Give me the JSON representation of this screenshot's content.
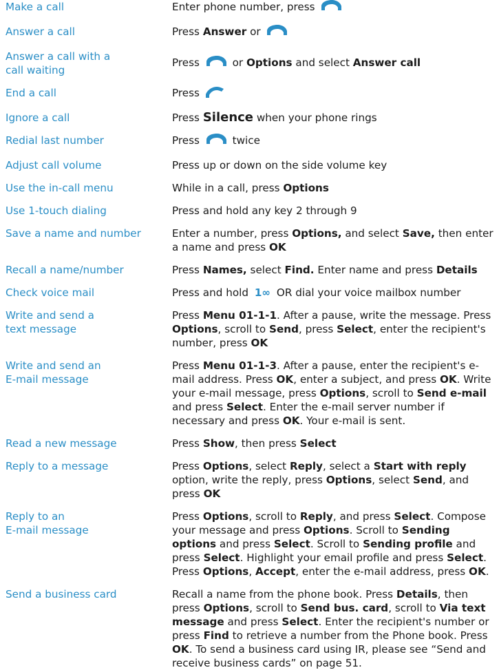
{
  "rows": [
    {
      "task": "Make a call",
      "parts": [
        [
          "t",
          "Enter phone number, press "
        ],
        [
          "icon",
          "send-key-icon"
        ]
      ]
    },
    {
      "task": "Answer a call",
      "parts": [
        [
          "t",
          "Press "
        ],
        [
          "b",
          "Answer"
        ],
        [
          "t",
          " or "
        ],
        [
          "icon",
          "send-key-icon"
        ]
      ]
    },
    {
      "task": "Answer a call with a\ncall waiting",
      "parts": [
        [
          "t",
          "Press "
        ],
        [
          "icon",
          "send-key-icon"
        ],
        [
          "t",
          " or "
        ],
        [
          "b",
          "Options"
        ],
        [
          "t",
          " and select "
        ],
        [
          "b",
          "Answer call"
        ]
      ]
    },
    {
      "task": "End a call",
      "parts": [
        [
          "t",
          "Press "
        ],
        [
          "icon",
          "end-key-icon"
        ]
      ]
    },
    {
      "task": "Ignore a call",
      "parts": [
        [
          "t",
          "Press "
        ],
        [
          "big",
          "Silence"
        ],
        [
          "t",
          " when your phone rings"
        ]
      ]
    },
    {
      "task": "Redial last number",
      "parts": [
        [
          "t",
          "Press "
        ],
        [
          "icon",
          "send-key-icon"
        ],
        [
          "t",
          " twice"
        ]
      ]
    },
    {
      "task": "Adjust call volume",
      "parts": [
        [
          "t",
          "Press up or down on the side volume key"
        ]
      ]
    },
    {
      "task": "Use the in-call menu",
      "parts": [
        [
          "t",
          "While in a call, press "
        ],
        [
          "b",
          "Options"
        ]
      ]
    },
    {
      "task": "Use 1-touch dialing",
      "parts": [
        [
          "t",
          "Press and hold any key 2 through 9"
        ]
      ]
    },
    {
      "task": "Save a name and number",
      "parts": [
        [
          "t",
          "Enter a number, press "
        ],
        [
          "b",
          "Options,"
        ],
        [
          "t",
          " and select "
        ],
        [
          "b",
          "Save,"
        ],
        [
          "t",
          " then enter a name and press "
        ],
        [
          "b",
          "OK"
        ]
      ]
    },
    {
      "task": "Recall a name/number",
      "parts": [
        [
          "t",
          "Press "
        ],
        [
          "b",
          "Names,"
        ],
        [
          "t",
          " select "
        ],
        [
          "b",
          "Find."
        ],
        [
          "t",
          " Enter name and press "
        ],
        [
          "b",
          "Details"
        ]
      ]
    },
    {
      "task": "Check voice mail",
      "parts": [
        [
          "t",
          "Press and hold "
        ],
        [
          "key",
          "1∞"
        ],
        [
          "t",
          " OR dial your voice mailbox number"
        ]
      ]
    },
    {
      "task": "Write and send a\ntext message",
      "parts": [
        [
          "t",
          "Press "
        ],
        [
          "b",
          "Menu 01-1-1"
        ],
        [
          "t",
          ". After a pause, write the message. Press "
        ],
        [
          "b",
          "Options"
        ],
        [
          "t",
          ", scroll to "
        ],
        [
          "b",
          "Send"
        ],
        [
          "t",
          ", press "
        ],
        [
          "b",
          "Select"
        ],
        [
          "t",
          ", enter the recipient's number, press "
        ],
        [
          "b",
          "OK"
        ]
      ]
    },
    {
      "task": "Write and send an\nE-mail message",
      "parts": [
        [
          "t",
          "Press "
        ],
        [
          "b",
          "Menu 01-1-3"
        ],
        [
          "t",
          ". After a pause, enter the recipient's e-mail address. Press "
        ],
        [
          "b",
          "OK"
        ],
        [
          "t",
          ", enter a subject, and press "
        ],
        [
          "b",
          "OK"
        ],
        [
          "t",
          ". Write your e-mail message, press "
        ],
        [
          "b",
          "Options"
        ],
        [
          "t",
          ", scroll to "
        ],
        [
          "b",
          "Send e-mail"
        ],
        [
          "t",
          " and press "
        ],
        [
          "b",
          "Select"
        ],
        [
          "t",
          ". Enter the e-mail server number if necessary and press "
        ],
        [
          "b",
          "OK"
        ],
        [
          "t",
          ". Your e-mail is sent."
        ]
      ]
    },
    {
      "task": "Read a new message",
      "parts": [
        [
          "t",
          "Press "
        ],
        [
          "b",
          "Show"
        ],
        [
          "t",
          ", then press "
        ],
        [
          "b",
          "Select"
        ]
      ]
    },
    {
      "task": "Reply to a message",
      "parts": [
        [
          "t",
          "Press "
        ],
        [
          "b",
          "Options"
        ],
        [
          "t",
          ", select "
        ],
        [
          "b",
          "Reply"
        ],
        [
          "t",
          ", select a "
        ],
        [
          "b",
          "Start with reply"
        ],
        [
          "t",
          " option, write the reply, press "
        ],
        [
          "b",
          "Options"
        ],
        [
          "t",
          ", select "
        ],
        [
          "b",
          "Send"
        ],
        [
          "t",
          ", and press "
        ],
        [
          "b",
          "OK"
        ]
      ]
    },
    {
      "task": "Reply to an\nE-mail message",
      "parts": [
        [
          "t",
          "Press "
        ],
        [
          "b",
          "Options"
        ],
        [
          "t",
          ", scroll to "
        ],
        [
          "b",
          "Reply"
        ],
        [
          "t",
          ", and press "
        ],
        [
          "b",
          "Select"
        ],
        [
          "t",
          ". Compose your message and press "
        ],
        [
          "b",
          "Options"
        ],
        [
          "t",
          ". Scroll to "
        ],
        [
          "b",
          "Sending options"
        ],
        [
          "t",
          " and press "
        ],
        [
          "b",
          "Select"
        ],
        [
          "t",
          ". Scroll to "
        ],
        [
          "b",
          "Sending profile"
        ],
        [
          "t",
          " and press "
        ],
        [
          "b",
          "Select"
        ],
        [
          "t",
          ". Highlight your email profile and press "
        ],
        [
          "b",
          "Select"
        ],
        [
          "t",
          ". Press "
        ],
        [
          "b",
          "Options"
        ],
        [
          "t",
          ", "
        ],
        [
          "b",
          "Accept"
        ],
        [
          "t",
          ", enter the e-mail address, press "
        ],
        [
          "b",
          "OK"
        ],
        [
          "t",
          "."
        ]
      ]
    },
    {
      "task": "Send a business card",
      "parts": [
        [
          "t",
          "Recall a name from the phone book. Press "
        ],
        [
          "b",
          "Details"
        ],
        [
          "t",
          ", then press "
        ],
        [
          "b",
          "Options"
        ],
        [
          "t",
          ", scroll to "
        ],
        [
          "b",
          "Send bus. card"
        ],
        [
          "t",
          ", scroll to "
        ],
        [
          "b",
          "Via text message"
        ],
        [
          "t",
          " and press "
        ],
        [
          "b",
          "Select"
        ],
        [
          "t",
          ". Enter the recipient's number or press "
        ],
        [
          "b",
          "Find"
        ],
        [
          "t",
          " to retrieve a number from the Phone book. Press "
        ],
        [
          "b",
          "OK"
        ],
        [
          "t",
          ". To send a business card using IR, please see “Send and receive business cards” on page 51."
        ]
      ]
    }
  ]
}
